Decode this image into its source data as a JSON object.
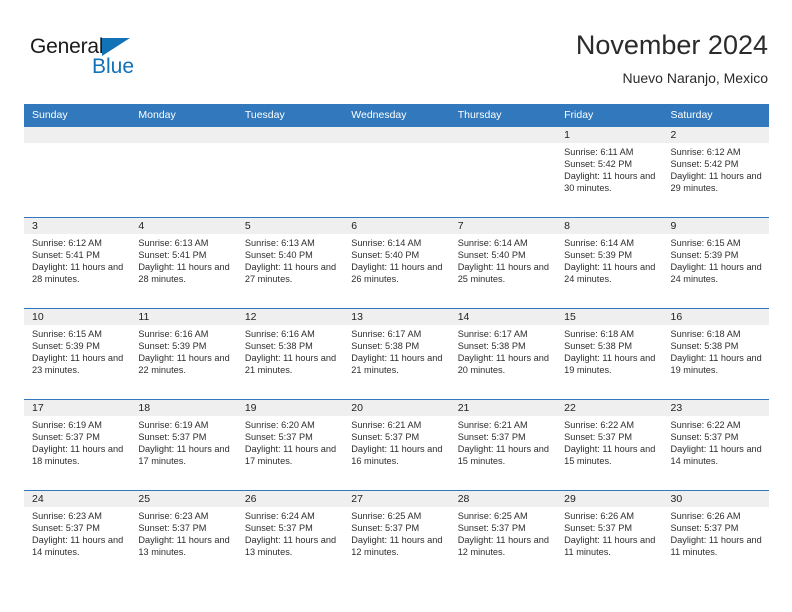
{
  "brand": {
    "name_part1": "General",
    "name_part2": "Blue",
    "accent_color": "#1272b8"
  },
  "header": {
    "title": "November 2024",
    "subtitle": "Nuevo Naranjo, Mexico",
    "header_bg_color": "#3179bc"
  },
  "labels": {
    "sunrise_prefix": "Sunrise:",
    "sunset_prefix": "Sunset:",
    "daylight_prefix": "Daylight:"
  },
  "weekdays": [
    "Sunday",
    "Monday",
    "Tuesday",
    "Wednesday",
    "Thursday",
    "Friday",
    "Saturday"
  ],
  "weeks": [
    [
      {
        "day": "",
        "sunrise": "",
        "sunset": "",
        "daylight": ""
      },
      {
        "day": "",
        "sunrise": "",
        "sunset": "",
        "daylight": ""
      },
      {
        "day": "",
        "sunrise": "",
        "sunset": "",
        "daylight": ""
      },
      {
        "day": "",
        "sunrise": "",
        "sunset": "",
        "daylight": ""
      },
      {
        "day": "",
        "sunrise": "",
        "sunset": "",
        "daylight": ""
      },
      {
        "day": "1",
        "sunrise": "Sunrise: 6:11 AM",
        "sunset": "Sunset: 5:42 PM",
        "daylight": "Daylight: 11 hours and 30 minutes."
      },
      {
        "day": "2",
        "sunrise": "Sunrise: 6:12 AM",
        "sunset": "Sunset: 5:42 PM",
        "daylight": "Daylight: 11 hours and 29 minutes."
      }
    ],
    [
      {
        "day": "3",
        "sunrise": "Sunrise: 6:12 AM",
        "sunset": "Sunset: 5:41 PM",
        "daylight": "Daylight: 11 hours and 28 minutes."
      },
      {
        "day": "4",
        "sunrise": "Sunrise: 6:13 AM",
        "sunset": "Sunset: 5:41 PM",
        "daylight": "Daylight: 11 hours and 28 minutes."
      },
      {
        "day": "5",
        "sunrise": "Sunrise: 6:13 AM",
        "sunset": "Sunset: 5:40 PM",
        "daylight": "Daylight: 11 hours and 27 minutes."
      },
      {
        "day": "6",
        "sunrise": "Sunrise: 6:14 AM",
        "sunset": "Sunset: 5:40 PM",
        "daylight": "Daylight: 11 hours and 26 minutes."
      },
      {
        "day": "7",
        "sunrise": "Sunrise: 6:14 AM",
        "sunset": "Sunset: 5:40 PM",
        "daylight": "Daylight: 11 hours and 25 minutes."
      },
      {
        "day": "8",
        "sunrise": "Sunrise: 6:14 AM",
        "sunset": "Sunset: 5:39 PM",
        "daylight": "Daylight: 11 hours and 24 minutes."
      },
      {
        "day": "9",
        "sunrise": "Sunrise: 6:15 AM",
        "sunset": "Sunset: 5:39 PM",
        "daylight": "Daylight: 11 hours and 24 minutes."
      }
    ],
    [
      {
        "day": "10",
        "sunrise": "Sunrise: 6:15 AM",
        "sunset": "Sunset: 5:39 PM",
        "daylight": "Daylight: 11 hours and 23 minutes."
      },
      {
        "day": "11",
        "sunrise": "Sunrise: 6:16 AM",
        "sunset": "Sunset: 5:39 PM",
        "daylight": "Daylight: 11 hours and 22 minutes."
      },
      {
        "day": "12",
        "sunrise": "Sunrise: 6:16 AM",
        "sunset": "Sunset: 5:38 PM",
        "daylight": "Daylight: 11 hours and 21 minutes."
      },
      {
        "day": "13",
        "sunrise": "Sunrise: 6:17 AM",
        "sunset": "Sunset: 5:38 PM",
        "daylight": "Daylight: 11 hours and 21 minutes."
      },
      {
        "day": "14",
        "sunrise": "Sunrise: 6:17 AM",
        "sunset": "Sunset: 5:38 PM",
        "daylight": "Daylight: 11 hours and 20 minutes."
      },
      {
        "day": "15",
        "sunrise": "Sunrise: 6:18 AM",
        "sunset": "Sunset: 5:38 PM",
        "daylight": "Daylight: 11 hours and 19 minutes."
      },
      {
        "day": "16",
        "sunrise": "Sunrise: 6:18 AM",
        "sunset": "Sunset: 5:38 PM",
        "daylight": "Daylight: 11 hours and 19 minutes."
      }
    ],
    [
      {
        "day": "17",
        "sunrise": "Sunrise: 6:19 AM",
        "sunset": "Sunset: 5:37 PM",
        "daylight": "Daylight: 11 hours and 18 minutes."
      },
      {
        "day": "18",
        "sunrise": "Sunrise: 6:19 AM",
        "sunset": "Sunset: 5:37 PM",
        "daylight": "Daylight: 11 hours and 17 minutes."
      },
      {
        "day": "19",
        "sunrise": "Sunrise: 6:20 AM",
        "sunset": "Sunset: 5:37 PM",
        "daylight": "Daylight: 11 hours and 17 minutes."
      },
      {
        "day": "20",
        "sunrise": "Sunrise: 6:21 AM",
        "sunset": "Sunset: 5:37 PM",
        "daylight": "Daylight: 11 hours and 16 minutes."
      },
      {
        "day": "21",
        "sunrise": "Sunrise: 6:21 AM",
        "sunset": "Sunset: 5:37 PM",
        "daylight": "Daylight: 11 hours and 15 minutes."
      },
      {
        "day": "22",
        "sunrise": "Sunrise: 6:22 AM",
        "sunset": "Sunset: 5:37 PM",
        "daylight": "Daylight: 11 hours and 15 minutes."
      },
      {
        "day": "23",
        "sunrise": "Sunrise: 6:22 AM",
        "sunset": "Sunset: 5:37 PM",
        "daylight": "Daylight: 11 hours and 14 minutes."
      }
    ],
    [
      {
        "day": "24",
        "sunrise": "Sunrise: 6:23 AM",
        "sunset": "Sunset: 5:37 PM",
        "daylight": "Daylight: 11 hours and 14 minutes."
      },
      {
        "day": "25",
        "sunrise": "Sunrise: 6:23 AM",
        "sunset": "Sunset: 5:37 PM",
        "daylight": "Daylight: 11 hours and 13 minutes."
      },
      {
        "day": "26",
        "sunrise": "Sunrise: 6:24 AM",
        "sunset": "Sunset: 5:37 PM",
        "daylight": "Daylight: 11 hours and 13 minutes."
      },
      {
        "day": "27",
        "sunrise": "Sunrise: 6:25 AM",
        "sunset": "Sunset: 5:37 PM",
        "daylight": "Daylight: 11 hours and 12 minutes."
      },
      {
        "day": "28",
        "sunrise": "Sunrise: 6:25 AM",
        "sunset": "Sunset: 5:37 PM",
        "daylight": "Daylight: 11 hours and 12 minutes."
      },
      {
        "day": "29",
        "sunrise": "Sunrise: 6:26 AM",
        "sunset": "Sunset: 5:37 PM",
        "daylight": "Daylight: 11 hours and 11 minutes."
      },
      {
        "day": "30",
        "sunrise": "Sunrise: 6:26 AM",
        "sunset": "Sunset: 5:37 PM",
        "daylight": "Daylight: 11 hours and 11 minutes."
      }
    ]
  ]
}
